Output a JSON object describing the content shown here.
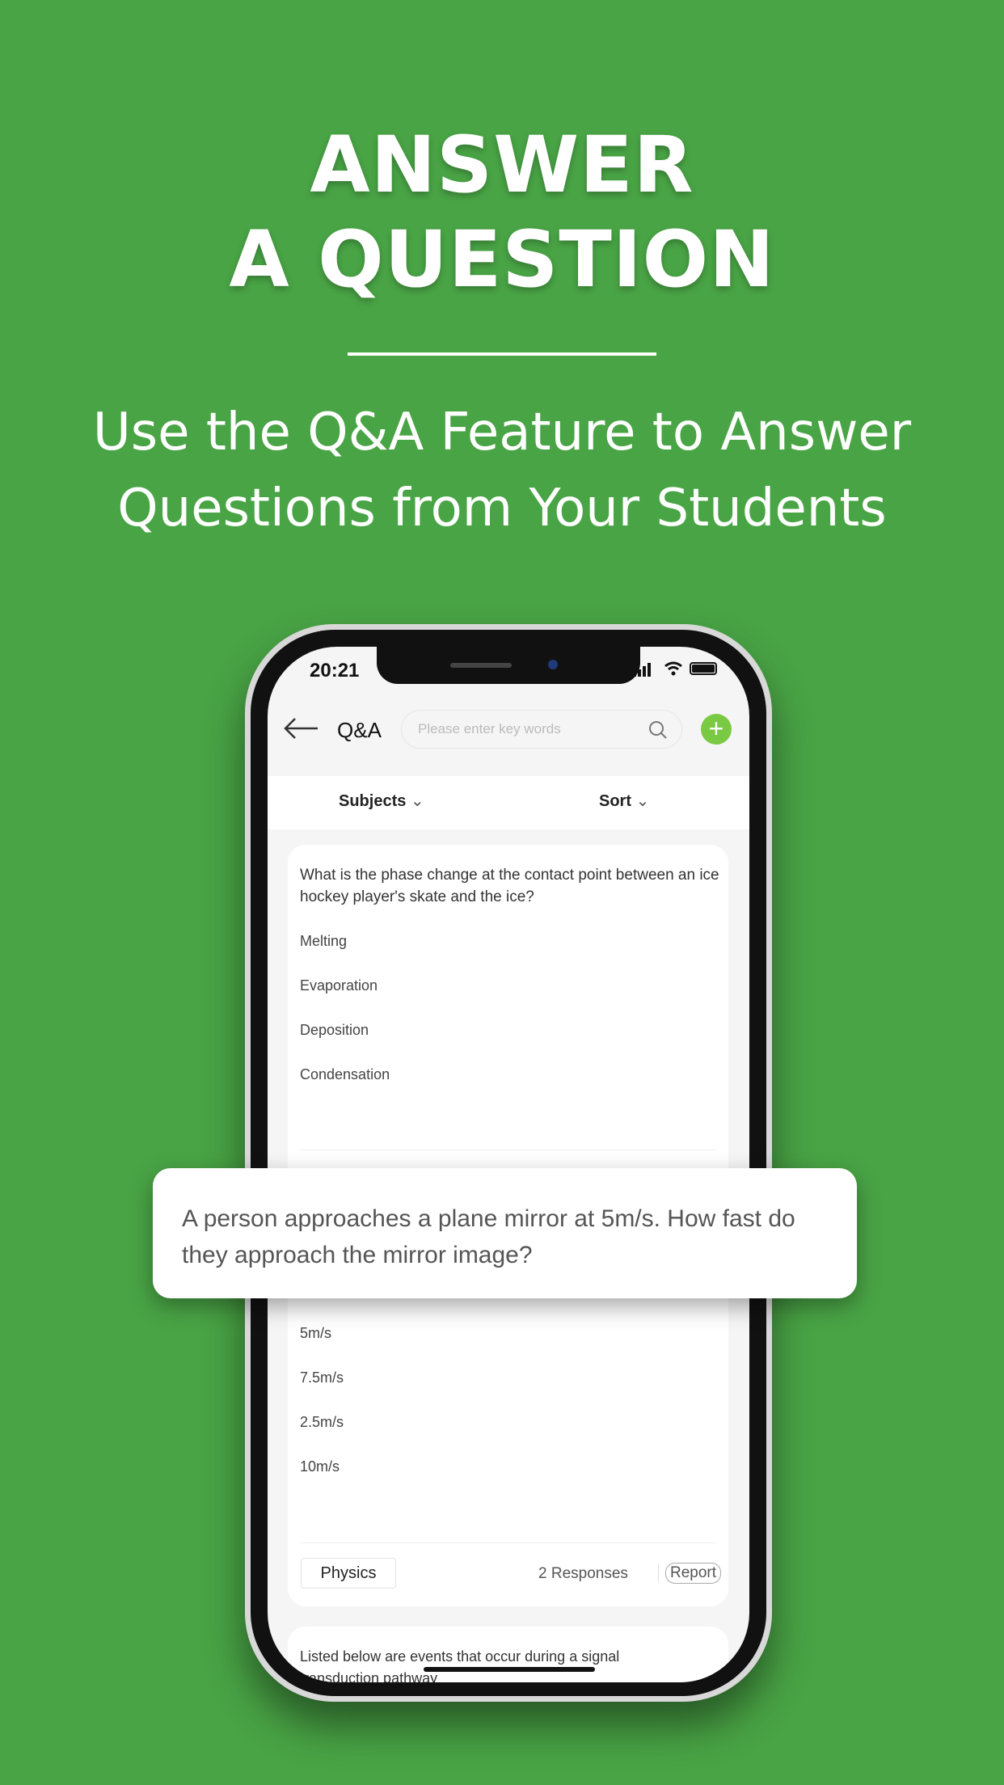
{
  "hero": {
    "title_line1": "ANSWER",
    "title_line2": "A QUESTION",
    "subtitle_line1": "Use the Q&A Feature to Answer",
    "subtitle_line2": "Questions from Your Students"
  },
  "status": {
    "time": "20:21"
  },
  "nav": {
    "title": "Q&A",
    "search_placeholder": "Please enter key words",
    "accent": "#7ac943"
  },
  "filters": {
    "subjects": "Subjects",
    "sort": "Sort"
  },
  "questions": [
    {
      "text": "What is the phase change at the contact point between an ice hockey player's skate and the ice?",
      "options": [
        "Melting",
        "Evaporation",
        "Deposition",
        "Condensation"
      ]
    },
    {
      "text": "A person approaches a plane mirror at 5m/s. How fast do they approach the mirror image?",
      "options": [
        "5m/s",
        "7.5m/s",
        "2.5m/s",
        "10m/s"
      ],
      "subject": "Physics",
      "responses": "2 Responses",
      "report": "Report"
    },
    {
      "text": "Listed below are events that occur during a signal transduction pathway"
    }
  ],
  "colors": {
    "background": "#49a445"
  }
}
